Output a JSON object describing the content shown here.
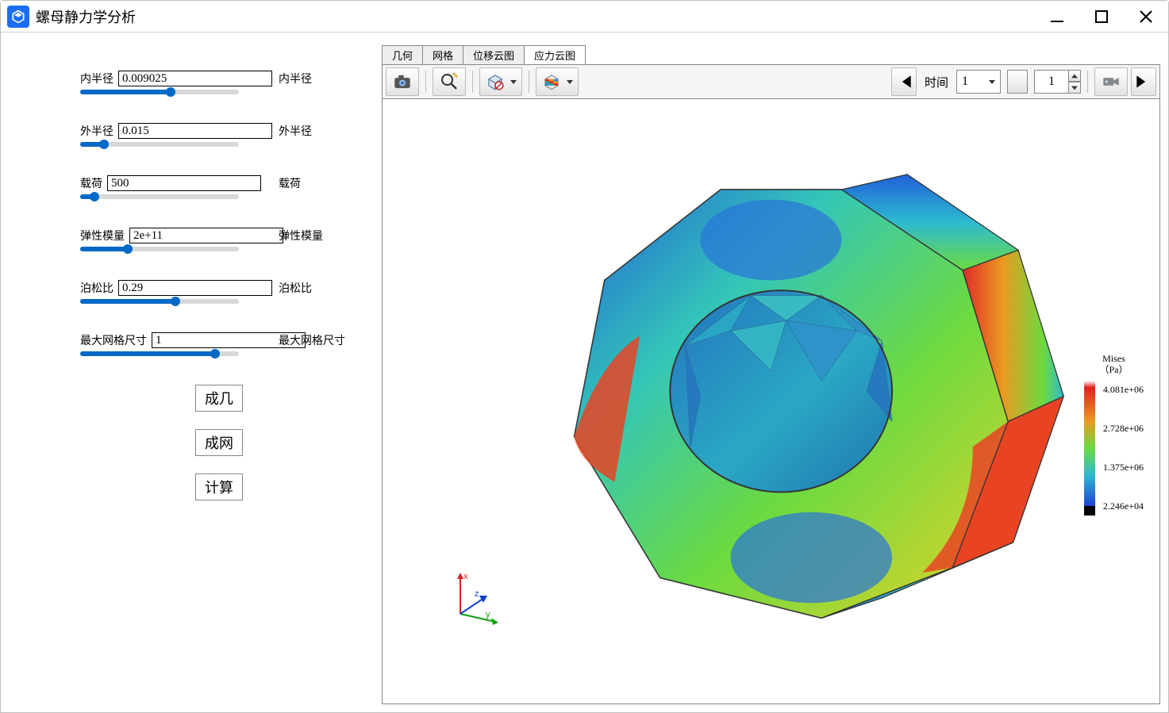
{
  "window": {
    "title": "螺母静力学分析"
  },
  "params": [
    {
      "label": "内半径",
      "value": "0.009025",
      "desc": "内半径",
      "pct": 57
    },
    {
      "label": "外半径",
      "value": "0.015",
      "desc": "外半径",
      "pct": 15
    },
    {
      "label": "载荷",
      "value": "500",
      "desc": "载荷",
      "pct": 9
    },
    {
      "label": "弹性模量",
      "value": "2e+11",
      "desc": "弹性模量",
      "pct": 30
    },
    {
      "label": "泊松比",
      "value": "0.29",
      "desc": "泊松比",
      "pct": 60
    },
    {
      "label": "最大网格尺寸",
      "value": "1",
      "desc": "最大网格尺寸",
      "pct": 85
    }
  ],
  "buttons": {
    "gen_geom": "成几",
    "gen_mesh": "成网",
    "compute": "计算"
  },
  "tabs": [
    "几何",
    "网格",
    "位移云图",
    "应力云图"
  ],
  "active_tab": 3,
  "toolbar": {
    "time_label": "时间",
    "time_value": "1",
    "frame_value": "1"
  },
  "legend": {
    "title_line1": "Mises",
    "title_line2": "（Pa）",
    "ticks": [
      "4.081e+06",
      "2.728e+06",
      "1.375e+06",
      "2.246e+04"
    ]
  },
  "triad": {
    "x": "x",
    "y": "y",
    "z": "z"
  },
  "chart_data": {
    "type": "heatmap",
    "quantity": "Mises (Pa)",
    "colormap": "rainbow",
    "range_min": 22460.0,
    "range_max": 4081000.0,
    "ticks": [
      4081000.0,
      2728000.0,
      1375000.0,
      22460.0
    ]
  }
}
